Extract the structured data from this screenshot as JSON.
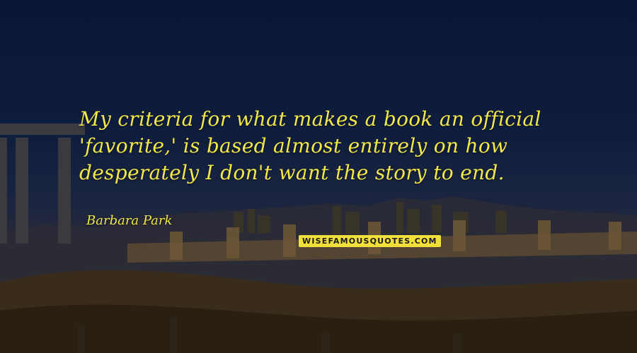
{
  "quote": {
    "lines": [
      "My criteria for what makes a book an official",
      "'favorite,' is based almost entirely on how",
      "desperately I don't want the story to end."
    ],
    "author": "Barbara Park"
  },
  "watermark": "WISEFAMOUSQUOTES.COM",
  "colors": {
    "text": "#f2e84a",
    "sky": "#0b1634",
    "badge_bg": "#f2e03a"
  }
}
